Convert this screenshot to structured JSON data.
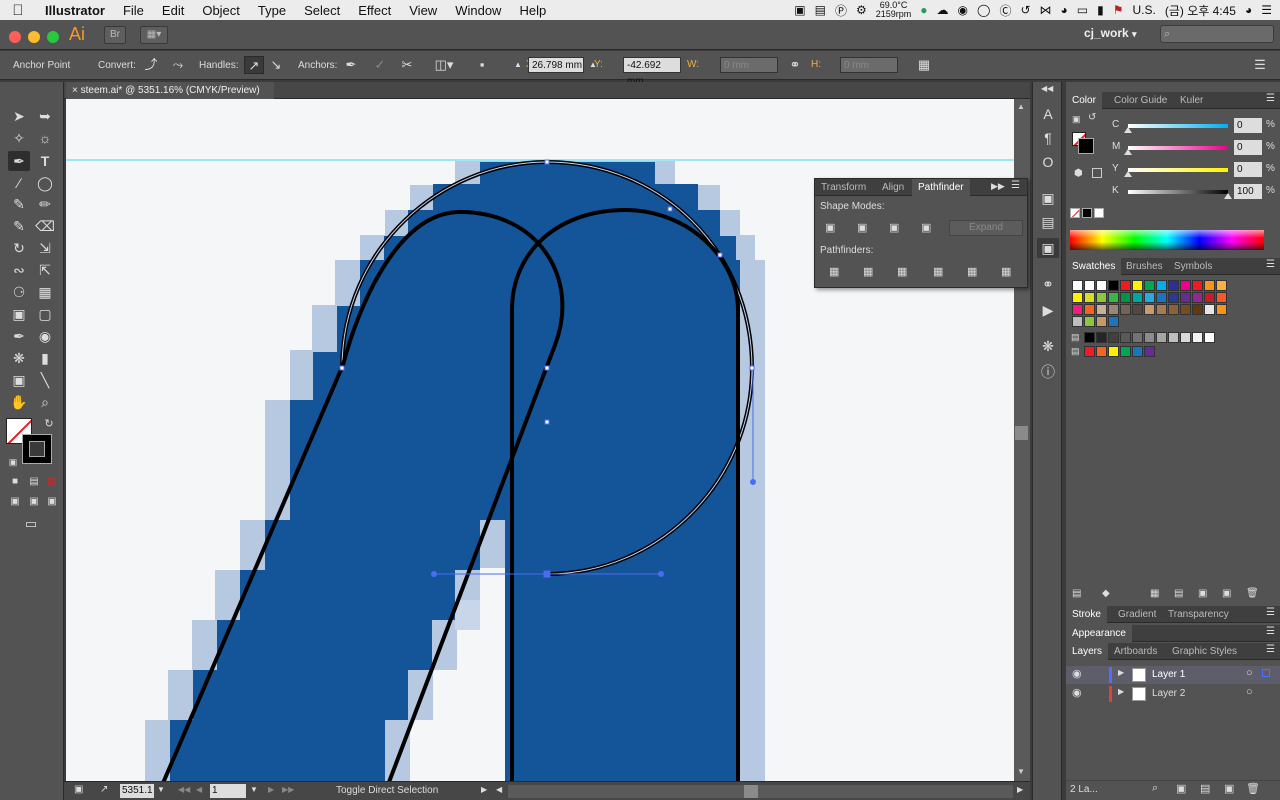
{
  "menubar": {
    "apple": "",
    "items": [
      "Illustrator",
      "File",
      "Edit",
      "Object",
      "Type",
      "Select",
      "Effect",
      "View",
      "Window",
      "Help"
    ],
    "temp_c": "69.0°C",
    "fan_rpm": "2159rpm",
    "locale": "U.S.",
    "clock": "(금) 오후 4:45"
  },
  "appbar": {
    "logo": "Ai",
    "workspace": "cj_work",
    "search_placeholder": ""
  },
  "control": {
    "mode_label": "Anchor Point",
    "convert_label": "Convert:",
    "handles_label": "Handles:",
    "anchors_label": "Anchors:",
    "x_label": "X:",
    "x_value": "26.798 mm",
    "y_label": "Y:",
    "y_value": "-42.692 mm",
    "w_label": "W:",
    "w_value": "0 mm",
    "h_label": "H:",
    "h_value": "0 mm"
  },
  "document": {
    "tab_title": "steem.ai* @ 5351.16% (CMYK/Preview)",
    "zoom": "5351.1",
    "artboard": "1",
    "status": "Toggle Direct Selection"
  },
  "pathfinder": {
    "tabs": [
      "Transform",
      "Align",
      "Pathfinder"
    ],
    "active_tab": "Pathfinder",
    "shape_modes_label": "Shape Modes:",
    "expand_label": "Expand",
    "pathfinders_label": "Pathfinders:"
  },
  "color_panel": {
    "tabs": [
      "Color",
      "Color Guide",
      "Kuler"
    ],
    "channels": [
      {
        "label": "C",
        "value": "0",
        "unit": "%"
      },
      {
        "label": "M",
        "value": "0",
        "unit": "%"
      },
      {
        "label": "Y",
        "value": "0",
        "unit": "%"
      },
      {
        "label": "K",
        "value": "100",
        "unit": "%"
      }
    ]
  },
  "swatches_panel": {
    "tabs": [
      "Swatches",
      "Brushes",
      "Symbols"
    ]
  },
  "stroke_panel": {
    "tabs": [
      "Stroke",
      "Gradient",
      "Transparency"
    ]
  },
  "appearance_panel": {
    "tabs": [
      "Appearance"
    ]
  },
  "layers_panel": {
    "tabs": [
      "Layers",
      "Artboards",
      "Graphic Styles"
    ],
    "layers": [
      {
        "name": "Layer 1",
        "color": "#4f6fff"
      },
      {
        "name": "Layer 2",
        "color": "#e04040"
      }
    ],
    "footer_count": "2 La..."
  },
  "colors": {
    "artwork_blue": "#14559a",
    "guide_cyan": "#41d8f0",
    "path_blue": "#4a6cf0",
    "menu_bg": "#ececec",
    "panel_bg": "#535353"
  }
}
